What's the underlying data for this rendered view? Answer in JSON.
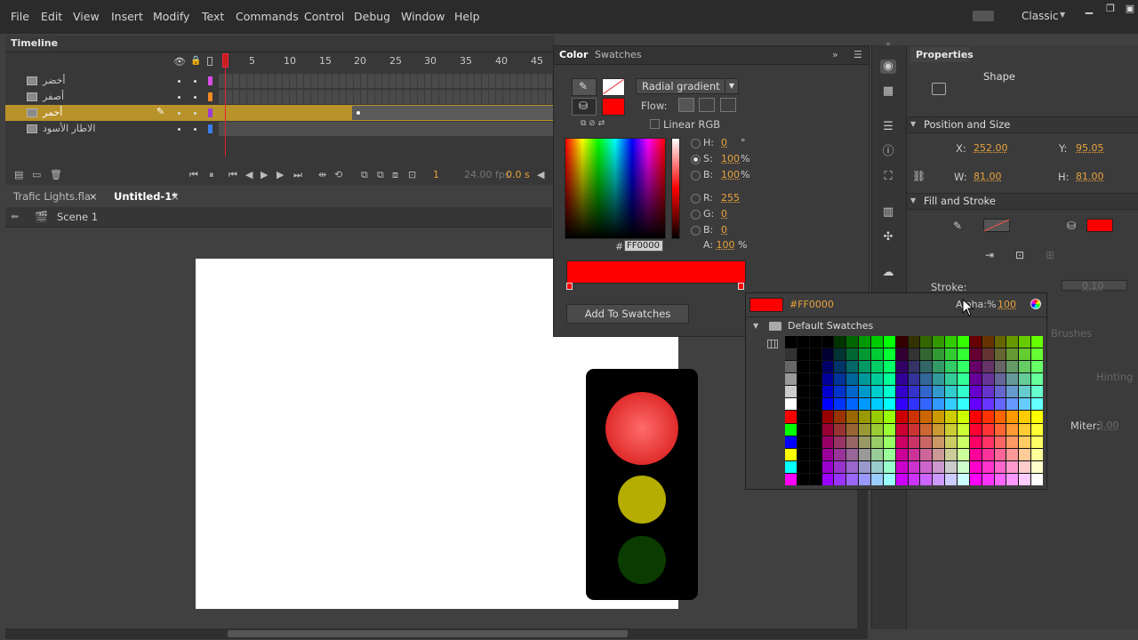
{
  "menubar": {
    "items": [
      "File",
      "Edit",
      "View",
      "Insert",
      "Modify",
      "Text",
      "Commands",
      "Control",
      "Debug",
      "Window",
      "Help"
    ],
    "workspace": "Classic"
  },
  "timeline": {
    "tab": "Timeline",
    "frame_numbers": [
      "1",
      "5",
      "10",
      "15",
      "20",
      "25",
      "30",
      "35",
      "40",
      "45"
    ],
    "layers": [
      {
        "name": "أخضر",
        "color": "#d84ce6"
      },
      {
        "name": "أصفر",
        "color": "#f08a24"
      },
      {
        "name": "أحمر",
        "color": "#9b3ad6",
        "active": true
      },
      {
        "name": "الاطار الأسود",
        "color": "#3a7ef0"
      }
    ],
    "current_frame": "1",
    "fps": "24.00 fps",
    "time": "0.0 s"
  },
  "documents": {
    "tabs": [
      {
        "label": "Trafic Lights.fla",
        "close": "×"
      },
      {
        "label": "Untitled-1*",
        "close": "×"
      }
    ],
    "scene": "Scene 1"
  },
  "stage": {
    "lights": {
      "red": "#e8383a",
      "yellow": "#b5ad00",
      "green": "#0b3b00"
    }
  },
  "color_panel": {
    "tabs": [
      "Color",
      "Swatches"
    ],
    "gradient_type": "Radial gradient",
    "flow_label": "Flow:",
    "linear_rgb": "Linear RGB",
    "hsb": [
      {
        "label": "H:",
        "value": "0",
        "unit": "°"
      },
      {
        "label": "S:",
        "value": "100",
        "unit": "%"
      },
      {
        "label": "B:",
        "value": "100",
        "unit": "%"
      }
    ],
    "rgb": [
      {
        "label": "R:",
        "value": "255",
        "unit": ""
      },
      {
        "label": "G:",
        "value": "0",
        "unit": ""
      },
      {
        "label": "B:",
        "value": "0",
        "unit": ""
      }
    ],
    "alpha": {
      "label": "A:",
      "value": "100",
      "unit": "%"
    },
    "hex_prefix": "#",
    "hex": "FF0000",
    "add_to_swatches": "Add To Swatches",
    "fill_color": "#ff0000"
  },
  "swatch_popup": {
    "hex": "#FF0000",
    "alpha_label": "Alpha:%",
    "alpha_value": "100",
    "default_swatches": "Default Swatches"
  },
  "properties": {
    "tab": "Properties",
    "type": "Shape",
    "position_size": "Position and Size",
    "x_label": "X:",
    "x": "252.00",
    "y_label": "Y:",
    "y": "95.05",
    "w_label": "W:",
    "w": "81.00",
    "h_label": "H:",
    "h": "81.00",
    "fill_stroke": "Fill and Stroke",
    "stroke_label": "Stroke:",
    "stroke_value": "0.10",
    "brushes": "Brushes",
    "hinting": "Hinting",
    "miter_label": "Miter:",
    "miter_value": "3.00"
  }
}
